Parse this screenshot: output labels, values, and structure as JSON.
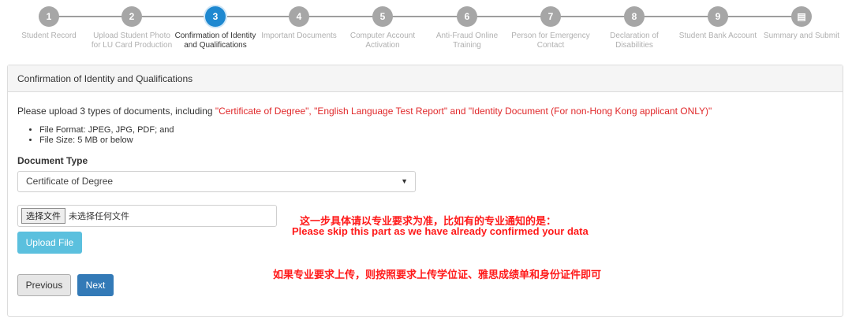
{
  "stepper": {
    "steps": [
      {
        "number": "1",
        "label_line1": "Student Record",
        "label_line2": ""
      },
      {
        "number": "2",
        "label_line1": "Upload Student Photo",
        "label_line2": "for LU Card Production"
      },
      {
        "number": "3",
        "label_line1": "Confirmation of Identity",
        "label_line2": "and Qualifications"
      },
      {
        "number": "4",
        "label_line1": "Important Documents",
        "label_line2": ""
      },
      {
        "number": "5",
        "label_line1": "Computer Account",
        "label_line2": "Activation"
      },
      {
        "number": "6",
        "label_line1": "Anti-Fraud Online",
        "label_line2": "Training"
      },
      {
        "number": "7",
        "label_line1": "Person for Emergency",
        "label_line2": "Contact"
      },
      {
        "number": "8",
        "label_line1": "Declaration of",
        "label_line2": "Disabilities"
      },
      {
        "number": "9",
        "label_line1": "Student Bank Account",
        "label_line2": ""
      },
      {
        "number": "▤",
        "label_line1": "Summary and Submit",
        "label_line2": ""
      }
    ],
    "active_index": 2,
    "active_color": "#1e88d0"
  },
  "panel": {
    "heading": "Confirmation of Identity and Qualifications",
    "intro_prefix": "Please upload 3 types of documents, including ",
    "intro_red": "\"Certificate of Degree\", \"English Language Test Report\" and \"Identity Document (For non-Hong Kong applicant ONLY)\"",
    "bullets": [
      "File Format: JPEG, JPG, PDF; and",
      "File Size: 5 MB or below"
    ],
    "doc_type_label": "Document Type",
    "doc_type_selected": "Certificate of Degree",
    "file_button": "选择文件",
    "file_status": "未选择任何文件",
    "upload_button": "Upload File",
    "previous_button": "Previous",
    "next_button": "Next"
  },
  "annotations": {
    "line1": "这一步具体请以专业要求为准，比如有的专业通知的是：",
    "line2": "Please skip this part as we have already confirmed your data",
    "line3": "如果专业要求上传，则按照要求上传学位证、雅思成绩单和身份证件即可"
  },
  "colors": {
    "red_text": "#e0282a",
    "upload_btn": "#5bc0de",
    "next_btn": "#337ab7"
  }
}
